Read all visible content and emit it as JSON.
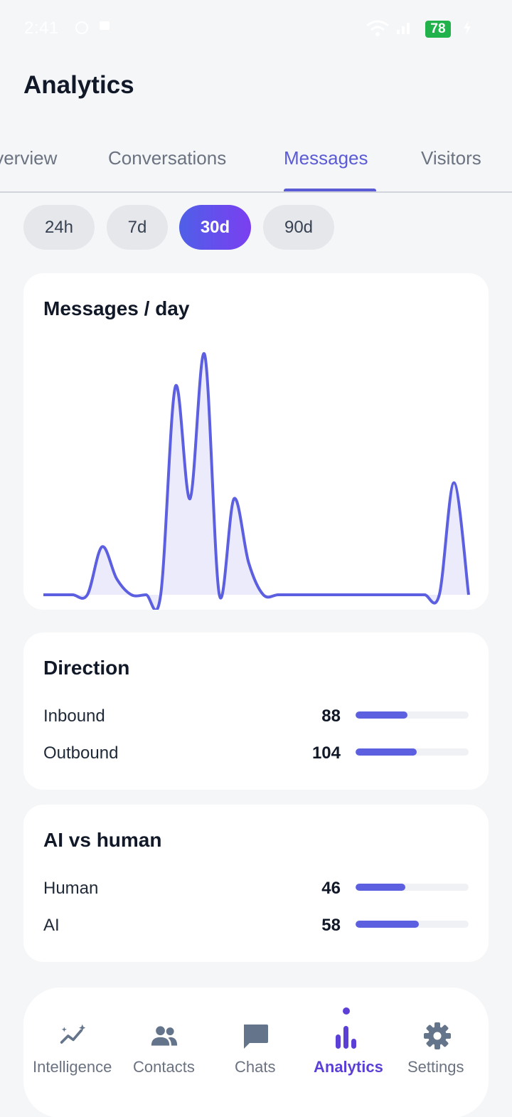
{
  "status_bar": {
    "time": "2:41",
    "battery": "78"
  },
  "header": {
    "title": "Analytics"
  },
  "tabs": [
    {
      "label": "Overview",
      "active": false
    },
    {
      "label": "Conversations",
      "active": false
    },
    {
      "label": "Messages",
      "active": true
    },
    {
      "label": "Visitors",
      "active": false
    }
  ],
  "ranges": [
    {
      "label": "24h",
      "active": false
    },
    {
      "label": "7d",
      "active": false
    },
    {
      "label": "30d",
      "active": true
    },
    {
      "label": "90d",
      "active": false
    }
  ],
  "messages_card": {
    "title": "Messages / day"
  },
  "chart_data": {
    "type": "area",
    "title": "Messages / day",
    "xlabel": "",
    "ylabel": "",
    "grid": false,
    "color": "#5b5fe0",
    "fill": "#ecebfb",
    "x": [
      0,
      1,
      2,
      3,
      4,
      5,
      6,
      7,
      8,
      9,
      10,
      11,
      12,
      13,
      14,
      15,
      16,
      17,
      18,
      19,
      20,
      21,
      22,
      23,
      24,
      25,
      26,
      27,
      28,
      29
    ],
    "y": [
      0,
      0,
      0,
      0,
      3,
      1,
      0,
      0,
      0,
      13,
      6,
      15,
      0,
      6,
      2,
      0,
      0,
      0,
      0,
      0,
      0,
      0,
      0,
      0,
      0,
      0,
      0,
      0,
      7,
      0
    ],
    "ylim": [
      0,
      16
    ]
  },
  "direction": {
    "title": "Direction",
    "rows": [
      {
        "label": "Inbound",
        "value": "88",
        "fraction": 0.46
      },
      {
        "label": "Outbound",
        "value": "104",
        "fraction": 0.54
      }
    ]
  },
  "ai_vs_human": {
    "title": "AI vs human",
    "rows": [
      {
        "label": "Human",
        "value": "46",
        "fraction": 0.44
      },
      {
        "label": "AI",
        "value": "58",
        "fraction": 0.56
      }
    ]
  },
  "nav": [
    {
      "label": "Intelligence",
      "icon": "sparkle-trend-icon",
      "active": false
    },
    {
      "label": "Contacts",
      "icon": "people-icon",
      "active": false
    },
    {
      "label": "Chats",
      "icon": "chat-bubble-icon",
      "active": false
    },
    {
      "label": "Analytics",
      "icon": "bar-chart-icon",
      "active": true
    },
    {
      "label": "Settings",
      "icon": "gear-icon",
      "active": false
    }
  ],
  "colors": {
    "accent": "#5b5bd6",
    "bar": "#5b5fe0"
  }
}
